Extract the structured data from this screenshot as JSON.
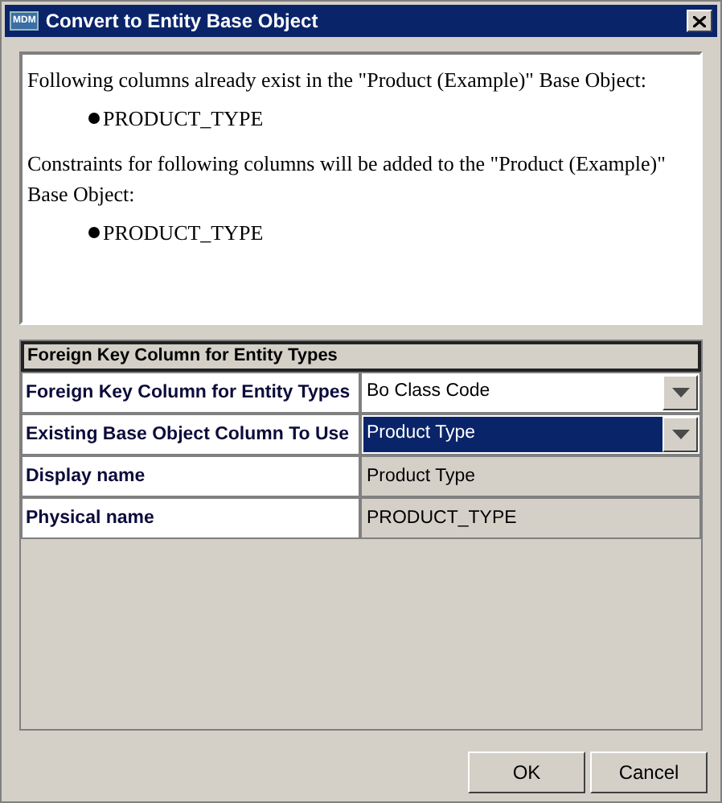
{
  "window": {
    "title": "Convert to Entity Base Object",
    "app_icon": "MDM"
  },
  "message": [
    {
      "text": "Following columns already exist in the \"Product (Example)\" Base Object:",
      "bullets": [
        "PRODUCT_TYPE"
      ]
    },
    {
      "text": "Constraints for following columns will be added to the \"Product (Example)\" Base Object:",
      "bullets": [
        "PRODUCT_TYPE"
      ]
    }
  ],
  "table": {
    "header": "Foreign Key Column for Entity Types",
    "rows": [
      {
        "label": "Foreign Key Column for Entity Types",
        "value": "Bo Class Code",
        "kind": "dropdown",
        "selected": false
      },
      {
        "label": "Existing Base Object Column To Use",
        "value": "Product Type",
        "kind": "dropdown",
        "selected": true
      },
      {
        "label": "Display name",
        "value": "Product Type",
        "kind": "readonly"
      },
      {
        "label": "Physical name",
        "value": "PRODUCT_TYPE",
        "kind": "readonly"
      }
    ]
  },
  "buttons": [
    "OK",
    "Cancel"
  ]
}
